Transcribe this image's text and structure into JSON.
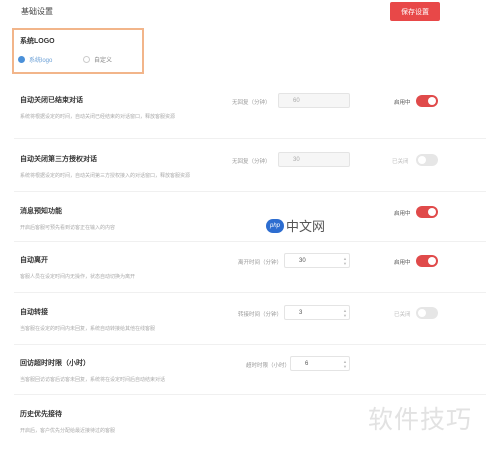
{
  "header": {
    "title": "基础设置",
    "save_label": "保存设置"
  },
  "logo": {
    "label": "系统LOGO",
    "options": [
      "系统logo",
      "自定义"
    ],
    "selected": 0
  },
  "sections": [
    {
      "title": "自动关闭已结束对话",
      "desc": "系统将根据设定的时间，自动关闭已经结束的对话窗口，释放客服资源",
      "field_label": "无回复（分钟）",
      "field_value": "60",
      "toggle_label": "启用中",
      "enabled": true
    },
    {
      "title": "自动关闭第三方授权对话",
      "desc": "系统将根据设定的时间，自动关闭第三方授权接入的对话窗口，释放客服资源",
      "field_label": "无回复（分钟）",
      "field_value": "30",
      "toggle_label": "已关闭",
      "enabled": false
    },
    {
      "title": "消息预知功能",
      "desc": "开启后客服可预先看到访客正在输入的内容",
      "toggle_label": "启用中",
      "enabled": true
    },
    {
      "title": "自动离开",
      "desc": "客服人员在设定时间内无操作，状态自动切换为离开",
      "field_label": "离开时间（分钟）",
      "field_value": "30",
      "toggle_label": "启用中",
      "enabled": true
    },
    {
      "title": "自动转接",
      "desc": "当客服在设定的时间内未回复，系统自动转接给其他在线客服",
      "field_label": "转接时间（分钟）",
      "field_value": "3",
      "toggle_label": "已关闭",
      "enabled": false
    },
    {
      "title": "回访超时时限（小时）",
      "desc": "当客服回访访客后访客未回复，系统将在设定时间后自动结束对话",
      "field_label": "超时时限（小时）",
      "field_value": "6"
    },
    {
      "title": "历史优先接待",
      "desc": "开启后，客户优先分配给最近接待过的客服"
    }
  ],
  "watermarks": {
    "php_badge": "php",
    "php_text": "中文网",
    "corner": "软件技巧"
  }
}
